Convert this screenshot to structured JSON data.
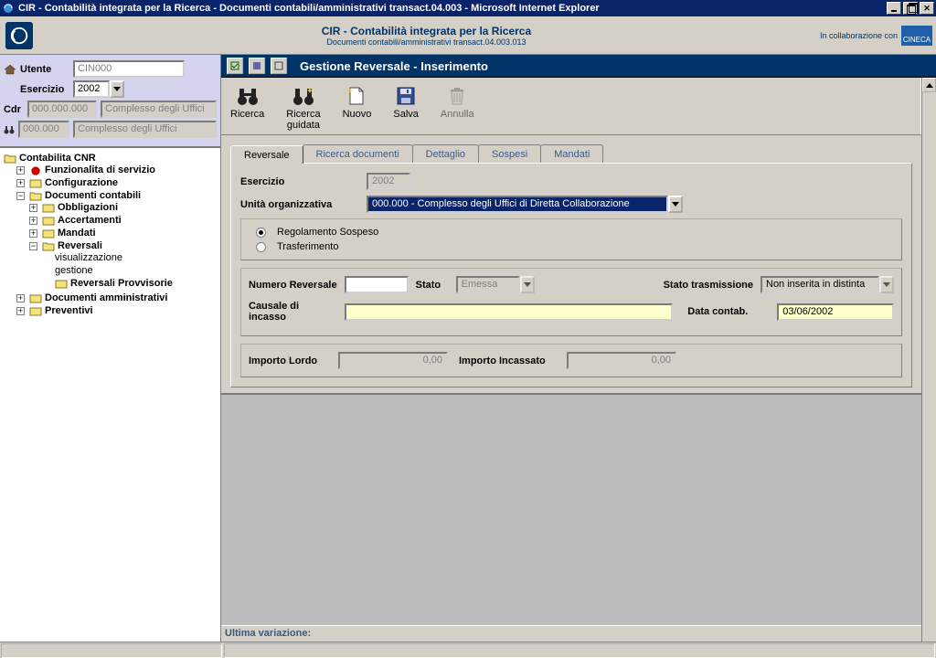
{
  "window": {
    "title": "CIR - Contabilità integrata per la Ricerca - Documenti contabili/amministrativi transact.04.003 - Microsoft Internet Explorer"
  },
  "brand": {
    "title": "CIR - Contabilità integrata per la Ricerca",
    "subtitle": "Documenti contabili/amministrativi transact.04.003.013",
    "collab": "In collaborazione con",
    "cineca": "CINECA"
  },
  "left": {
    "utente_label": "Utente",
    "utente_value": "CIN000",
    "esercizio_label": "Esercizio",
    "esercizio_value": "2002",
    "cdr_label": "Cdr",
    "cdr_code": "000.000.000",
    "cdr_desc": "Complesso degli Uffici",
    "search_code": "000.000",
    "search_desc": "Complesso degli Uffici"
  },
  "tree": {
    "root": "Contabilita CNR",
    "n1": "Funzionalita di servizio",
    "n2": "Configurazione",
    "n3": "Documenti contabili",
    "n3a": "Obbligazioni",
    "n3b": "Accertamenti",
    "n3c": "Mandati",
    "n3d": "Reversali",
    "n3d1": "visualizzazione",
    "n3d2": "gestione",
    "n3d3": "Reversali Provvisorie",
    "n4": "Documenti amministrativi",
    "n5": "Preventivi"
  },
  "panel": {
    "title": "Gestione Reversale - Inserimento"
  },
  "toolbar": {
    "ricerca": "Ricerca",
    "ricerca_guidata": "Ricerca\nguidata",
    "nuovo": "Nuovo",
    "salva": "Salva",
    "annulla": "Annulla"
  },
  "tabs": {
    "t1": "Reversale",
    "t2": "Ricerca documenti",
    "t3": "Dettaglio",
    "t4": "Sospesi",
    "t5": "Mandati"
  },
  "form": {
    "esercizio_label": "Esercizio",
    "esercizio_value": "2002",
    "org_label": "Unità organizzativa",
    "org_value": "000.000 - Complesso degli Uffici di Diretta Collaborazione",
    "radio1": "Regolamento Sospeso",
    "radio2": "Trasferimento",
    "num_label": "Numero Reversale",
    "num_value": "",
    "stato_label": "Stato",
    "stato_value": "Emessa",
    "stato_trasm_label": "Stato trasmissione",
    "stato_trasm_value": "Non inserita in distinta",
    "causale_label": "Causale di incasso",
    "causale_value": "",
    "data_label": "Data contab.",
    "data_value": "03/06/2002",
    "lordo_label": "Importo Lordo",
    "lordo_value": "0,00",
    "incassato_label": "Importo Incassato",
    "incassato_value": "0,00"
  },
  "footer": {
    "ultima": "Ultima variazione:"
  }
}
